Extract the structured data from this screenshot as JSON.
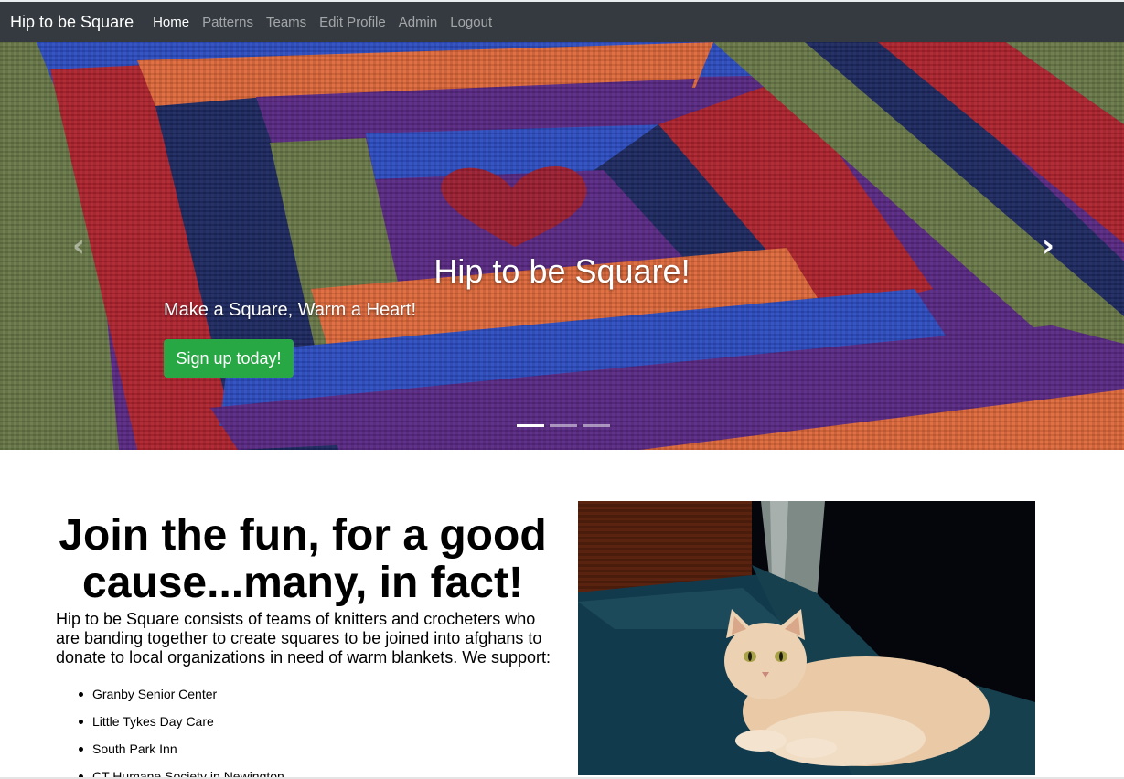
{
  "navbar": {
    "brand": "Hip to be Square",
    "links": [
      {
        "label": "Home",
        "active": true
      },
      {
        "label": "Patterns",
        "active": false
      },
      {
        "label": "Teams",
        "active": false
      },
      {
        "label": "Edit Profile",
        "active": false
      },
      {
        "label": "Admin",
        "active": false
      },
      {
        "label": "Logout",
        "active": false
      }
    ]
  },
  "carousel": {
    "title": "Hip to be Square!",
    "subtitle": "Make a Square, Warm a Heart!",
    "cta_label": "Sign up today!",
    "prev_icon": "chevron-left-icon",
    "next_icon": "chevron-right-icon",
    "slide_count": 3,
    "active_slide": 1
  },
  "main": {
    "heading": "Join the fun, for a good cause...many, in fact!",
    "intro": "Hip to be Square consists of teams of knitters and crocheters who are banding together to create squares to be joined into afghans to donate to local organizations in need of warm blankets. We support:",
    "organizations": [
      "Granby Senior Center",
      "Little Tykes Day Care",
      "South Park Inn",
      "CT Humane Society in Newington"
    ]
  },
  "colors": {
    "navbar_bg": "#343a40",
    "cta_green": "#28a745",
    "blanket_red": "#b0242f",
    "blanket_orange": "#e06a3c",
    "blanket_purple": "#5b2a86",
    "blanket_blue": "#2e4fc4",
    "blanket_navy": "#1e2a62",
    "blanket_green": "#6b7a4a"
  }
}
